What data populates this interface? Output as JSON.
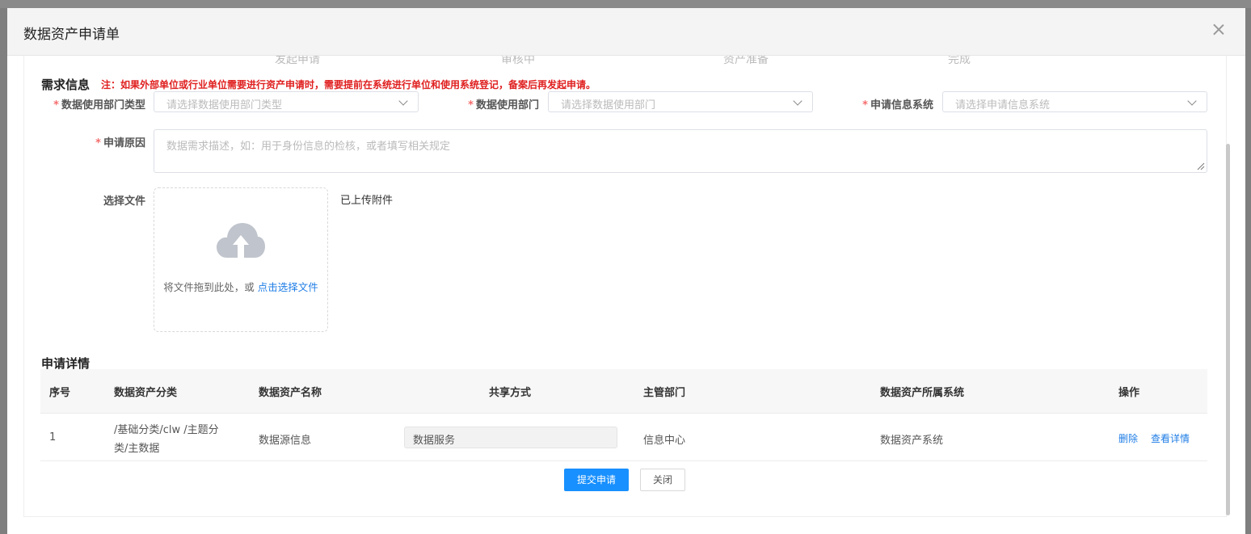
{
  "dialog": {
    "title": "数据资产申请单"
  },
  "steps": [
    "发起申请",
    "审核中",
    "资产准备",
    "完成"
  ],
  "requirements": {
    "section_title": "需求信息",
    "notice": "注：如果外部单位或行业单位需要进行资产申请时，需要提前在系统进行单位和使用系统登记，备案后再发起申请。",
    "required_mark": "*",
    "fields": {
      "dept_type": {
        "label": "数据使用部门类型",
        "placeholder": "请选择数据使用部门类型"
      },
      "dept": {
        "label": "数据使用部门",
        "placeholder": "请选择数据使用部门"
      },
      "system": {
        "label": "申请信息系统",
        "placeholder": "请选择申请信息系统"
      },
      "reason": {
        "label": "申请原因",
        "placeholder": "数据需求描述，如：用于身份信息的检核，或者填写相关规定"
      }
    },
    "file": {
      "label": "选择文件",
      "drop_hint": "将文件拖到此处，或 ",
      "select_link": "点击选择文件",
      "uploaded_label": "已上传附件"
    }
  },
  "details": {
    "section_title": "申请详情",
    "columns": [
      "序号",
      "数据资产分类",
      "数据资产名称",
      "共享方式",
      "主管部门",
      "数据资产所属系统",
      "操作"
    ],
    "rows": [
      {
        "index": "1",
        "category_line1": "/基础分类/clw /主题分",
        "category_line2": "类/主数据",
        "name": "数据源信息",
        "share": "数据服务",
        "dept": "信息中心",
        "system": "数据资产系统",
        "actions": [
          "删除",
          "查看详情"
        ]
      }
    ]
  },
  "buttons": {
    "submit": "提交申请",
    "close": "关闭"
  },
  "colors": {
    "primary": "#1890ff",
    "link": "#1f7de6",
    "required": "#f56c6c",
    "notice": "#e02020"
  },
  "icons": {
    "close": "close-icon",
    "upload": "cloud-upload-icon",
    "dropdown": "chevron-down-icon"
  }
}
